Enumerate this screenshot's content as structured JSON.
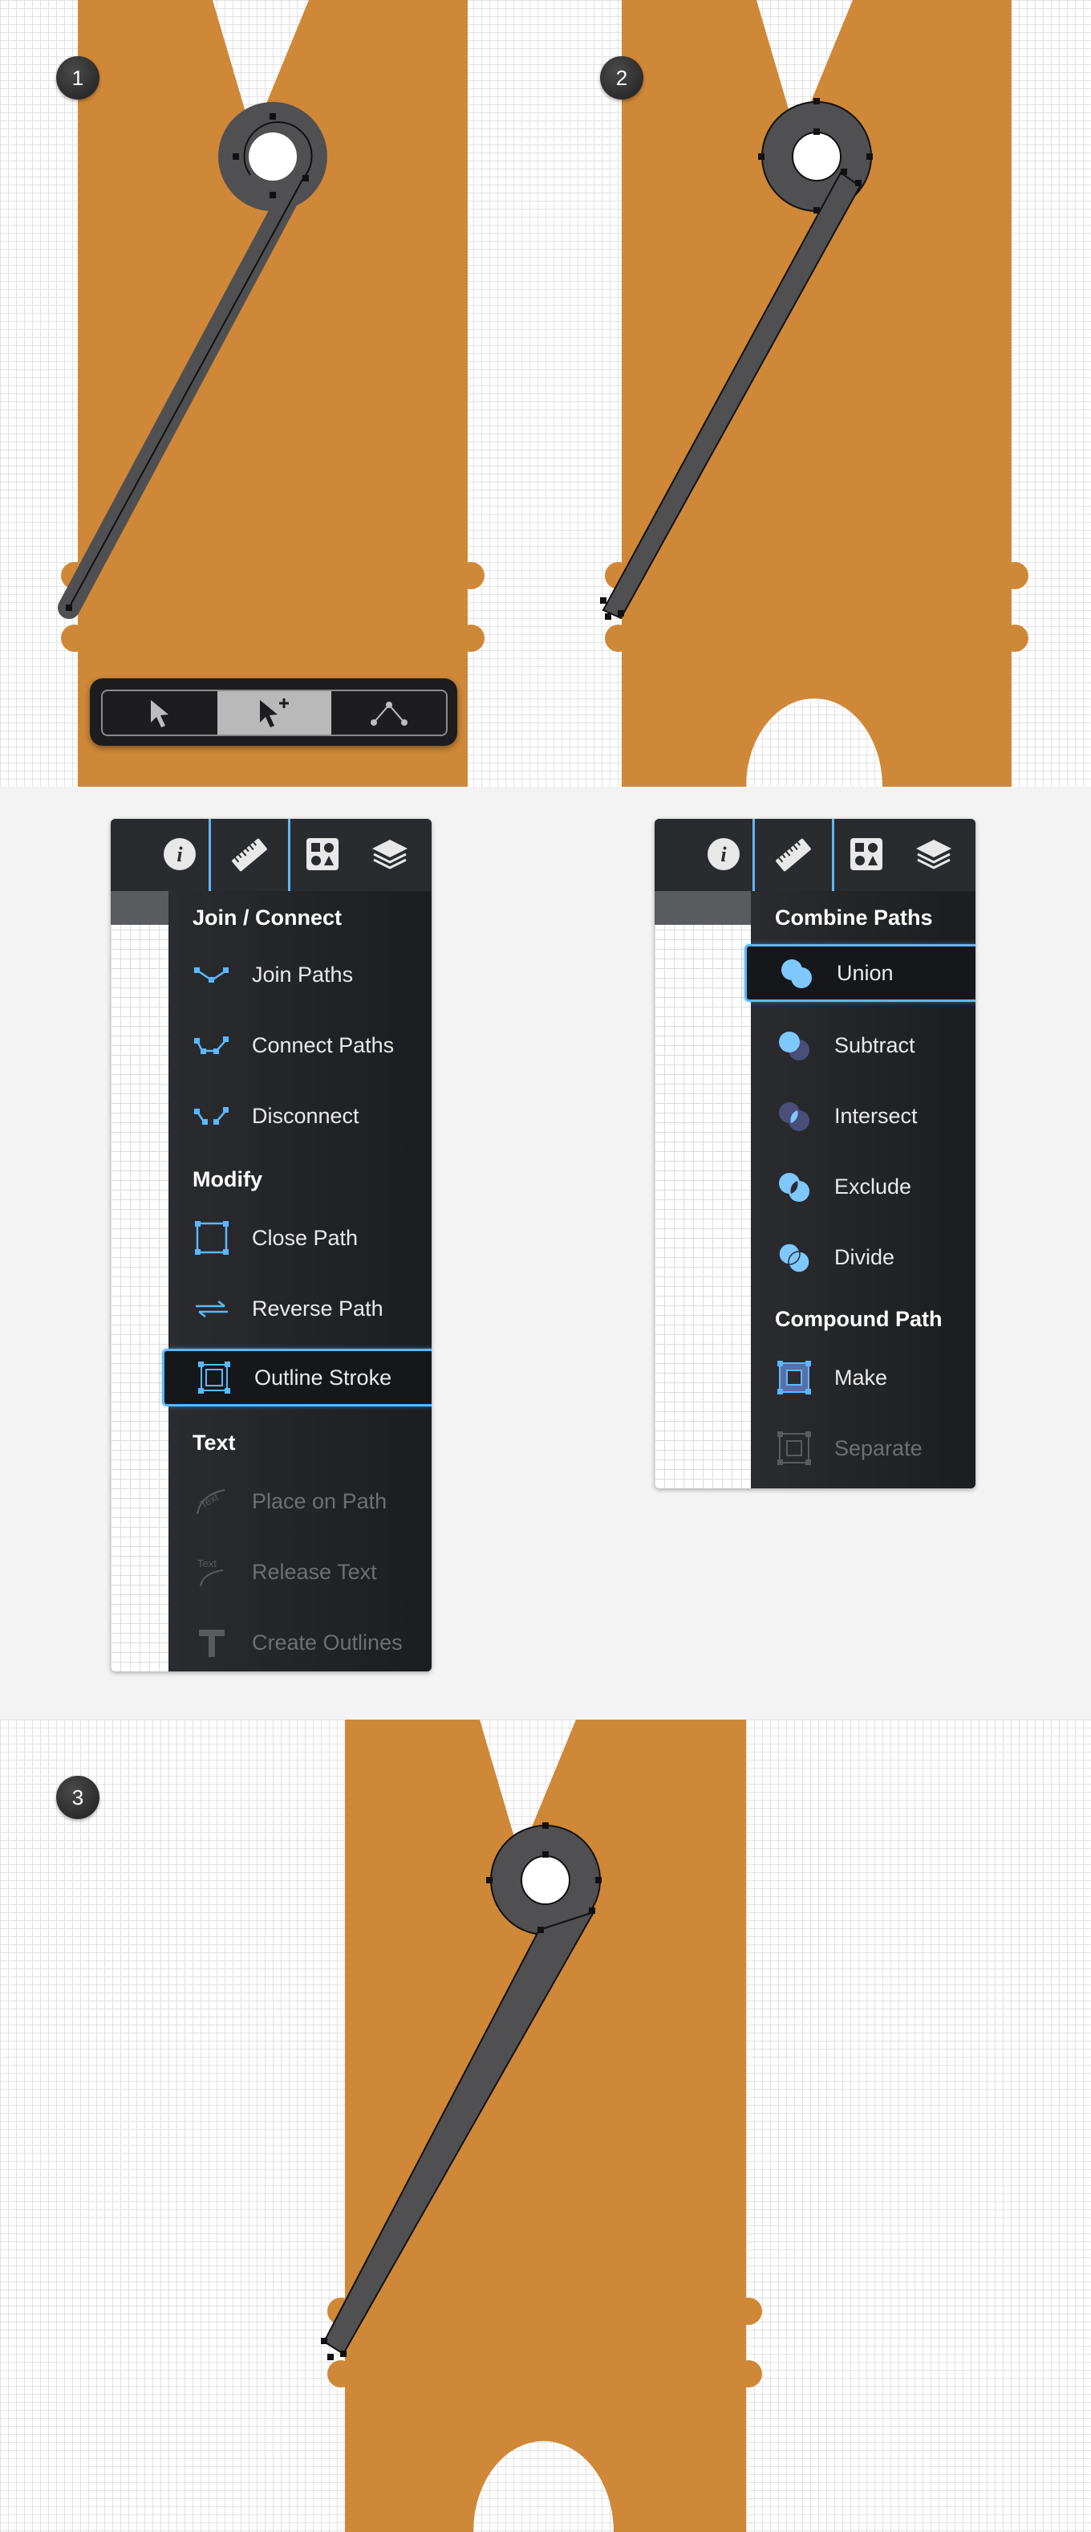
{
  "steps": {
    "one": "1",
    "two": "2",
    "three": "3"
  },
  "colors": {
    "wood": "#cf8838",
    "spring": "#505052",
    "accent": "#5bb8ff",
    "menu_bg": "#1e1f22"
  },
  "toolbar": {
    "tools": [
      {
        "icon": "arrow-pointer-icon",
        "active": false
      },
      {
        "icon": "arrow-pointer-plus-icon",
        "active": true
      },
      {
        "icon": "node-path-icon",
        "active": false
      }
    ]
  },
  "menu_left": {
    "top_icons": [
      "info-icon",
      "ruler-icon",
      "shapes-icon",
      "layers-icon"
    ],
    "selected_top_icon": "ruler-icon",
    "sections": [
      {
        "title": "Join / Connect",
        "items": [
          {
            "label": "Join Paths",
            "icon": "join-paths-icon"
          },
          {
            "label": "Connect Paths",
            "icon": "connect-paths-icon"
          },
          {
            "label": "Disconnect",
            "icon": "disconnect-icon"
          }
        ]
      },
      {
        "title": "Modify",
        "items": [
          {
            "label": "Close Path",
            "icon": "close-path-icon"
          },
          {
            "label": "Reverse Path",
            "icon": "reverse-path-icon"
          },
          {
            "label": "Outline Stroke",
            "icon": "outline-stroke-icon",
            "highlighted": true
          }
        ]
      },
      {
        "title": "Text",
        "items": [
          {
            "label": "Place on Path",
            "icon": "place-on-path-icon",
            "disabled": true
          },
          {
            "label": "Release Text",
            "icon": "release-text-icon",
            "disabled": true
          },
          {
            "label": "Create Outlines",
            "icon": "create-outlines-icon",
            "disabled": true
          }
        ]
      }
    ]
  },
  "menu_right": {
    "top_icons": [
      "info-icon",
      "ruler-icon",
      "shapes-icon",
      "layers-icon"
    ],
    "selected_top_icon": "ruler-icon",
    "sections": [
      {
        "title": "Combine Paths",
        "items": [
          {
            "label": "Union",
            "icon": "union-icon",
            "highlighted": true
          },
          {
            "label": "Subtract",
            "icon": "subtract-icon"
          },
          {
            "label": "Intersect",
            "icon": "intersect-icon"
          },
          {
            "label": "Exclude",
            "icon": "exclude-icon"
          },
          {
            "label": "Divide",
            "icon": "divide-icon"
          }
        ]
      },
      {
        "title": "Compound Path",
        "items": [
          {
            "label": "Make",
            "icon": "make-compound-icon"
          },
          {
            "label": "Separate",
            "icon": "separate-compound-icon",
            "disabled": true
          }
        ]
      }
    ]
  }
}
